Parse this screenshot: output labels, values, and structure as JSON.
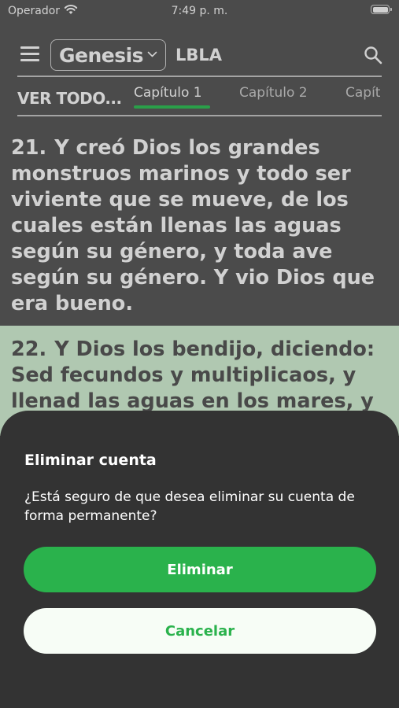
{
  "status_bar": {
    "carrier": "Operador",
    "time": "7:49 p. m."
  },
  "header": {
    "book": "Genesis",
    "version": "LBLA"
  },
  "tabs": {
    "all_label": "VER TODO...",
    "chapters": [
      {
        "label": "Capítulo 1",
        "active": true
      },
      {
        "label": "Capítulo 2",
        "active": false
      },
      {
        "label": "Capít",
        "active": false
      }
    ]
  },
  "verses": [
    {
      "number": "21.",
      "text": "Y creó Dios los grandes monstruos marinos y todo ser viviente que se mueve, de los cuales están llenas las aguas según su género, y toda ave según su género. Y vio Dios que era bueno."
    },
    {
      "number": "22.",
      "text": "Y Dios los bendijo, diciendo: Sed fecundos y multiplicaos, y llenad las aguas en los mares, y"
    }
  ],
  "dialog": {
    "title": "Eliminar cuenta",
    "message": "¿Está seguro de que desea eliminar su cuenta de forma permanente?",
    "confirm_label": "Eliminar",
    "cancel_label": "Cancelar"
  },
  "colors": {
    "accent": "#2ab24c",
    "highlight": "#d7f5d8",
    "sheet_bg": "#333333"
  }
}
